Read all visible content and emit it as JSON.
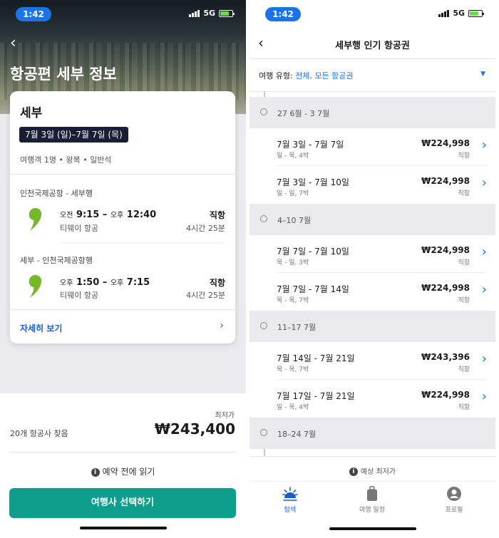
{
  "left": {
    "status": {
      "time": "1:42",
      "network": "5G"
    },
    "hero_title": "항공편 세부 정보",
    "card": {
      "city": "세부",
      "date_range": "7월 3일 (일)–7월 7일 (목)",
      "passengers": "여행객 1명 • 왕복 • 일반석",
      "legs": [
        {
          "route": "인천국제공항 - 세부행",
          "dep_period": "오전",
          "dep_time": "9:15",
          "arr_period": "오후",
          "arr_time": "12:40",
          "airline": "티웨이 항공",
          "type": "직항",
          "duration": "4시간 25분"
        },
        {
          "route": "세부 - 인천국제공항행",
          "dep_period": "오후",
          "dep_time": "1:50",
          "arr_period": "오후",
          "arr_time": "7:15",
          "airline": "티웨이 항공",
          "type": "직항",
          "duration": "4시간 25분"
        }
      ],
      "details_link": "자세히 보기"
    },
    "summary": {
      "lowest_label": "최저가",
      "airlines_found": "20개 항공사 찾음",
      "price": "₩243,400",
      "read_before": "예약 전에 읽기",
      "select_button": "여행사 선택하기"
    }
  },
  "right": {
    "status": {
      "time": "1:42",
      "network": "5G"
    },
    "title": "세부행 인기 항공권",
    "filter": {
      "label": "여행 유형: ",
      "value": "전체, 모든 항공권"
    },
    "weeks": [
      {
        "label": "27 6월 - 3 7월",
        "trips": [
          {
            "dates": "7월 3일 - 7월 7일",
            "sub": "일 - 목, 4박",
            "price": "₩224,998",
            "type": "직항"
          },
          {
            "dates": "7월 3일 - 7월 10일",
            "sub": "일 - 일, 7박",
            "price": "₩224,998",
            "type": "직항"
          }
        ]
      },
      {
        "label": "4–10 7월",
        "trips": [
          {
            "dates": "7월 7일 - 7월 10일",
            "sub": "목 - 일, 3박",
            "price": "₩224,998",
            "type": "직항"
          },
          {
            "dates": "7월 7일 - 7월 14일",
            "sub": "목 - 목, 7박",
            "price": "₩224,998",
            "type": "직항"
          }
        ]
      },
      {
        "label": "11–17 7월",
        "trips": [
          {
            "dates": "7월 14일 - 7월 21일",
            "sub": "목 - 목, 7박",
            "price": "₩243,396",
            "type": "직항"
          },
          {
            "dates": "7월 17일 - 7월 21일",
            "sub": "일 - 목, 4박",
            "price": "₩224,998",
            "type": "직항"
          }
        ]
      },
      {
        "label": "18–24 7월",
        "trips": []
      }
    ],
    "estimate_label": "예상 최저가",
    "tabs": [
      {
        "label": "탐색",
        "icon": "sunrise-icon"
      },
      {
        "label": "여행 일정",
        "icon": "suitcase-icon"
      },
      {
        "label": "프로필",
        "icon": "profile-icon"
      }
    ]
  },
  "colors": {
    "accent": "#1a73e8",
    "button": "#0d9e8c",
    "date_pill": "#161f35"
  }
}
